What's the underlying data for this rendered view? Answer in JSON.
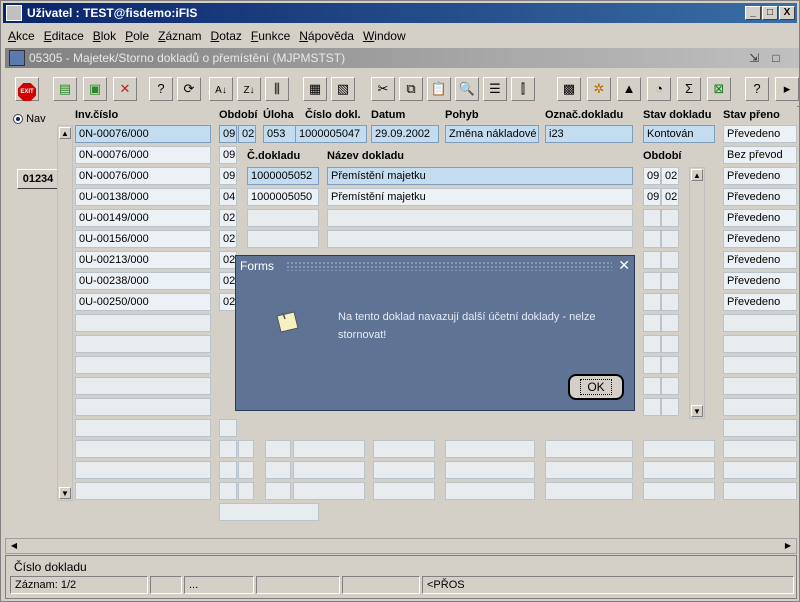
{
  "window": {
    "title": "Uživatel : TEST@fisdemo:iFIS",
    "minimize": "_",
    "maximize": "□",
    "close": "X"
  },
  "menu": [
    "Akce",
    "Editace",
    "Blok",
    "Pole",
    "Záznam",
    "Dotaz",
    "Funkce",
    "Nápověda",
    "Window"
  ],
  "form": {
    "title": "05305 - Majetek/Storno dokladů o přemístění (MJPMSTST)"
  },
  "toolbar": {
    "exit_label": "EXIT"
  },
  "nav": {
    "radio_label": "Nav",
    "badge": "01234"
  },
  "headers": {
    "inv": "Inv.číslo",
    "obdobi": "Období",
    "uloha": "Úloha",
    "cislo": "Číslo dokl.",
    "datum": "Datum",
    "pohyb": "Pohyb",
    "oznac": "Označ.dokladu",
    "stav": "Stav dokladu",
    "stav_pren": "Stav přeno"
  },
  "top_row": {
    "inv": "0N-00076/000",
    "obdobi": "09",
    "obdobi2": "02",
    "uloha": "053",
    "cislo": "1000005047",
    "datum": "29.09.2002",
    "pohyb": "Změna nákladové",
    "oznac": "i23",
    "stav": "Kontován",
    "stav_pren": "Převedeno"
  },
  "inv_rows": [
    "0N-00076/000",
    "0N-00076/000",
    "0U-00138/000",
    "0U-00149/000",
    "0U-00156/000",
    "0U-00213/000",
    "0U-00238/000",
    "0U-00250/000"
  ],
  "obdobi_rows": [
    "09",
    "09",
    "04",
    "02",
    "02",
    "02",
    "02",
    "02"
  ],
  "sub_headers": {
    "cdokladu": "Č.dokladu",
    "nazev": "Název dokladu",
    "obdobi": "Období"
  },
  "sub_rows": [
    {
      "cdokladu": "1000005052",
      "nazev": "Přemístění majetku",
      "o1": "09",
      "o2": "02"
    },
    {
      "cdokladu": "1000005050",
      "nazev": "Přemístění majetku",
      "o1": "09",
      "o2": "02"
    }
  ],
  "stav_pren_rows": [
    "Bez převod",
    "Převedeno",
    "Převedeno",
    "Převedeno",
    "Převedeno",
    "Převedeno",
    "Převedeno",
    "Převedeno"
  ],
  "dialog": {
    "title": "Forms",
    "message": "Na tento doklad navazují další účetní doklady - nelze stornovat!",
    "ok": "OK"
  },
  "status": {
    "message": "Číslo dokladu",
    "record": "Záznam: 1/2",
    "ellipsis": "...",
    "mode": "<PŘOS"
  }
}
